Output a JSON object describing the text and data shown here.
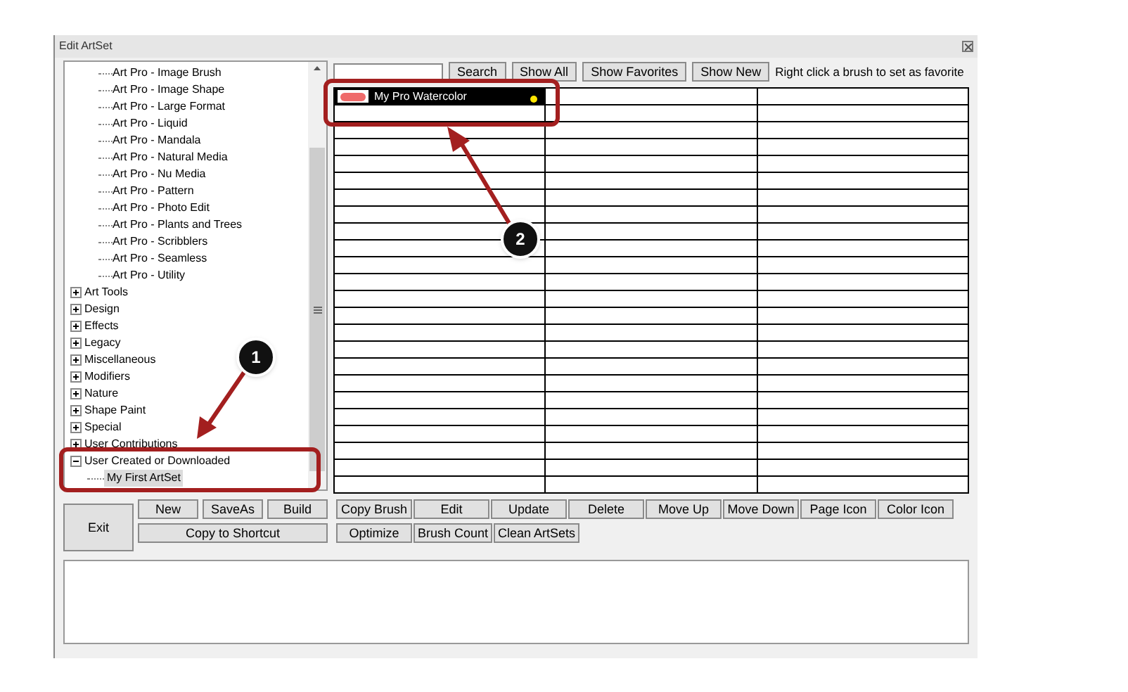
{
  "window": {
    "title": "Edit ArtSet"
  },
  "tree": {
    "leaves_above": [
      "Art Pro - Image Brush",
      "Art Pro - Image Shape",
      "Art Pro - Large Format",
      "Art Pro - Liquid",
      "Art Pro - Mandala",
      "Art Pro - Natural Media",
      "Art Pro - Nu Media",
      "Art Pro - Pattern",
      "Art Pro - Photo Edit",
      "Art Pro - Plants and Trees",
      "Art Pro - Scribblers",
      "Art Pro - Seamless",
      "Art Pro - Utility"
    ],
    "nodes": [
      {
        "label": "Art Tools",
        "expanded": false
      },
      {
        "label": "Design",
        "expanded": false
      },
      {
        "label": "Effects",
        "expanded": false
      },
      {
        "label": "Legacy",
        "expanded": false
      },
      {
        "label": "Miscellaneous",
        "expanded": false
      },
      {
        "label": "Modifiers",
        "expanded": false
      },
      {
        "label": "Nature",
        "expanded": false
      },
      {
        "label": "Shape Paint",
        "expanded": false
      },
      {
        "label": "Special",
        "expanded": false
      },
      {
        "label": "User Contributions",
        "expanded": false
      },
      {
        "label": "User Created or Downloaded",
        "expanded": true,
        "children": [
          {
            "label": "My First ArtSet",
            "selected": true
          }
        ]
      }
    ]
  },
  "toolbar": {
    "search_buttons": [
      "Search",
      "Show All",
      "Show Favorites",
      "Show New"
    ],
    "hint": "Right click a brush to set as favorite"
  },
  "brush_grid": {
    "brushes": [
      {
        "name": "My Pro Watercolor",
        "selected": true,
        "favorite": true
      }
    ]
  },
  "left_buttons": {
    "exit": "Exit",
    "row1": [
      "New",
      "SaveAs",
      "Build"
    ],
    "row2": [
      "Copy to Shortcut"
    ]
  },
  "right_buttons": {
    "row1": [
      "Copy Brush",
      "Edit",
      "Update",
      "Delete",
      "Move Up",
      "Move Down",
      "Page Icon",
      "Color Icon"
    ],
    "row2": [
      "Optimize",
      "Brush Count",
      "Clean ArtSets"
    ]
  },
  "callouts": [
    {
      "number": "1"
    },
    {
      "number": "2"
    }
  ]
}
